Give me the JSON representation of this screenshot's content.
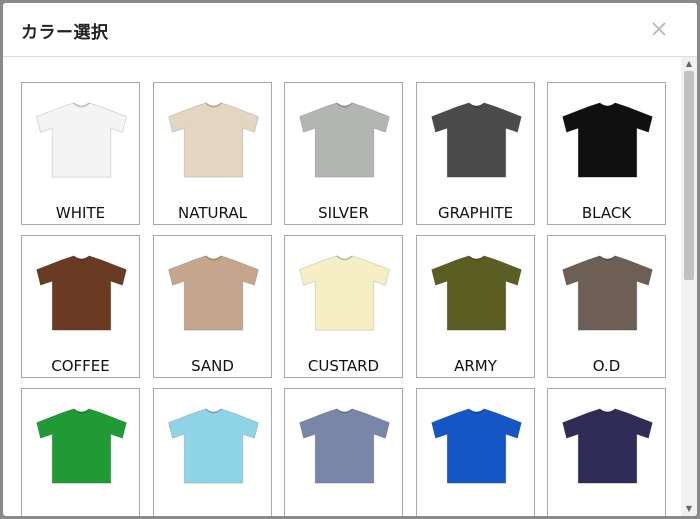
{
  "modal": {
    "title": "カラー選択",
    "close_icon": "close-icon"
  },
  "colors": [
    {
      "label": "WHITE",
      "color": "#f4f4f4"
    },
    {
      "label": "NATURAL",
      "color": "#e3d6c1"
    },
    {
      "label": "SILVER",
      "color": "#b3b5b2"
    },
    {
      "label": "GRAPHITE",
      "color": "#4b4b4b"
    },
    {
      "label": "BLACK",
      "color": "#101010"
    },
    {
      "label": "COFFEE",
      "color": "#6a3a22"
    },
    {
      "label": "SAND",
      "color": "#c5a58d"
    },
    {
      "label": "CUSTARD",
      "color": "#f6efc6"
    },
    {
      "label": "ARMY",
      "color": "#5a5e22"
    },
    {
      "label": "O.D",
      "color": "#6d5f55"
    },
    {
      "label": "",
      "color": "#1f9a34"
    },
    {
      "label": "",
      "color": "#8fd4e6"
    },
    {
      "label": "",
      "color": "#7a86a8"
    },
    {
      "label": "",
      "color": "#1356c4"
    },
    {
      "label": "",
      "color": "#2f2c57"
    }
  ]
}
